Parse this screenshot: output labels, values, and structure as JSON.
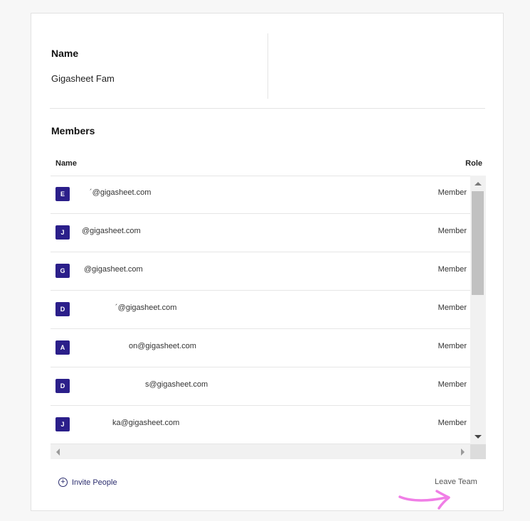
{
  "team": {
    "name_label": "Name",
    "name_value": "Gigasheet Fam"
  },
  "members": {
    "title": "Members",
    "columns": {
      "name": "Name",
      "role": "Role"
    },
    "rows": [
      {
        "initial": "E",
        "email": "´@gigasheet.com",
        "role": "Member"
      },
      {
        "initial": "J",
        "email": "@gigasheet.com",
        "role": "Member"
      },
      {
        "initial": "G",
        "email": "@gigasheet.com",
        "role": "Member"
      },
      {
        "initial": "D",
        "email": "´@gigasheet.com",
        "role": "Member"
      },
      {
        "initial": "A",
        "email": "on@gigasheet.com",
        "role": "Member"
      },
      {
        "initial": "D",
        "email": "s@gigasheet.com",
        "role": "Member"
      },
      {
        "initial": "J",
        "email": "ka@gigasheet.com",
        "role": "Member"
      }
    ]
  },
  "actions": {
    "invite_label": "Invite People",
    "leave_label": "Leave Team"
  },
  "colors": {
    "avatar_bg": "#2b1f8a",
    "annotation": "#f07ee6",
    "link": "#2b2d6e"
  }
}
